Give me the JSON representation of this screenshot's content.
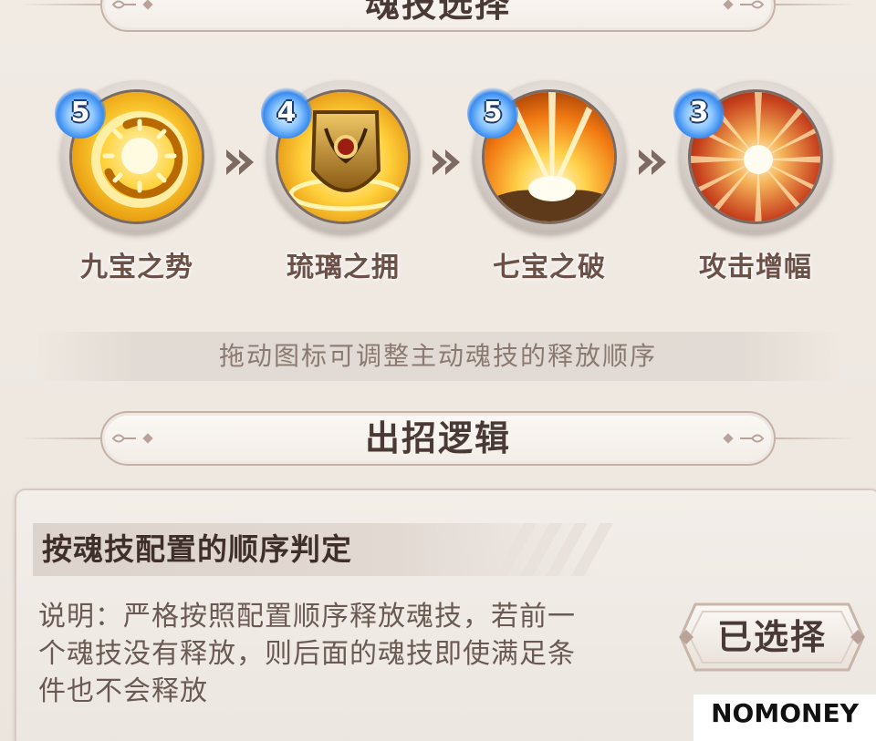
{
  "sections": {
    "skill_select_title": "魂技选择",
    "logic_title": "出招逻辑"
  },
  "skills": [
    {
      "level": "5",
      "name": "九宝之势",
      "icon": "golden-ring-sun-icon"
    },
    {
      "level": "4",
      "name": "琉璃之拥",
      "icon": "golden-shield-icon"
    },
    {
      "level": "5",
      "name": "七宝之破",
      "icon": "light-burst-icon"
    },
    {
      "level": "3",
      "name": "攻击增幅",
      "icon": "radial-burst-icon"
    }
  ],
  "hint": "拖动图标可调整主动魂技的释放顺序",
  "logic": {
    "option_title": "按魂技配置的顺序判定",
    "description_lines": [
      "说明：严格按照配置顺序释放魂技，若前一",
      "个魂技没有释放，则后面的魂技即使满足条",
      "件也不会释放"
    ],
    "button_label": "已选择"
  },
  "watermark": "NOMONEY",
  "colors": {
    "title_text": "#4a3a35",
    "skill_name": "#6b5148",
    "hint_text": "#8b7a72",
    "level_badge": "#3a8cf0"
  }
}
